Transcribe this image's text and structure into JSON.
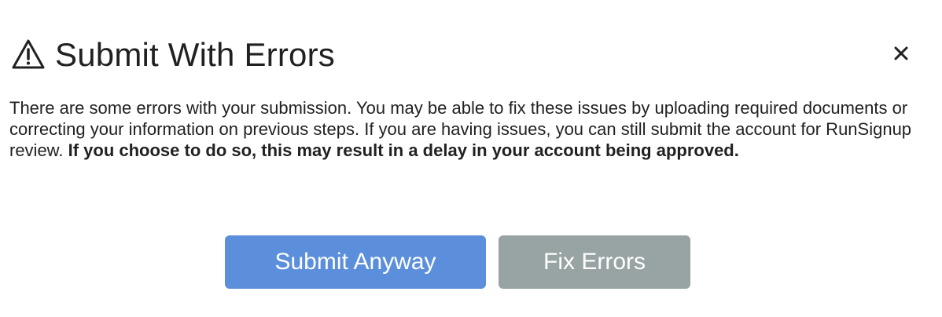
{
  "dialog": {
    "title": "Submit With Errors",
    "warning_icon": "warning-triangle-icon",
    "close_icon": "close-icon",
    "message_plain": "There are some errors with your submission. You may be able to fix these issues by uploading required documents or correcting your information on previous steps. If you are having issues, you can still submit the account for RunSignup review. ",
    "message_bold": "If you choose to do so, this may result in a delay in your account being approved.",
    "buttons": {
      "submit_label": "Submit Anyway",
      "fix_label": "Fix Errors"
    }
  },
  "colors": {
    "primary_button": "#5b8fdc",
    "secondary_button": "#98a3a3",
    "text": "#212121"
  }
}
